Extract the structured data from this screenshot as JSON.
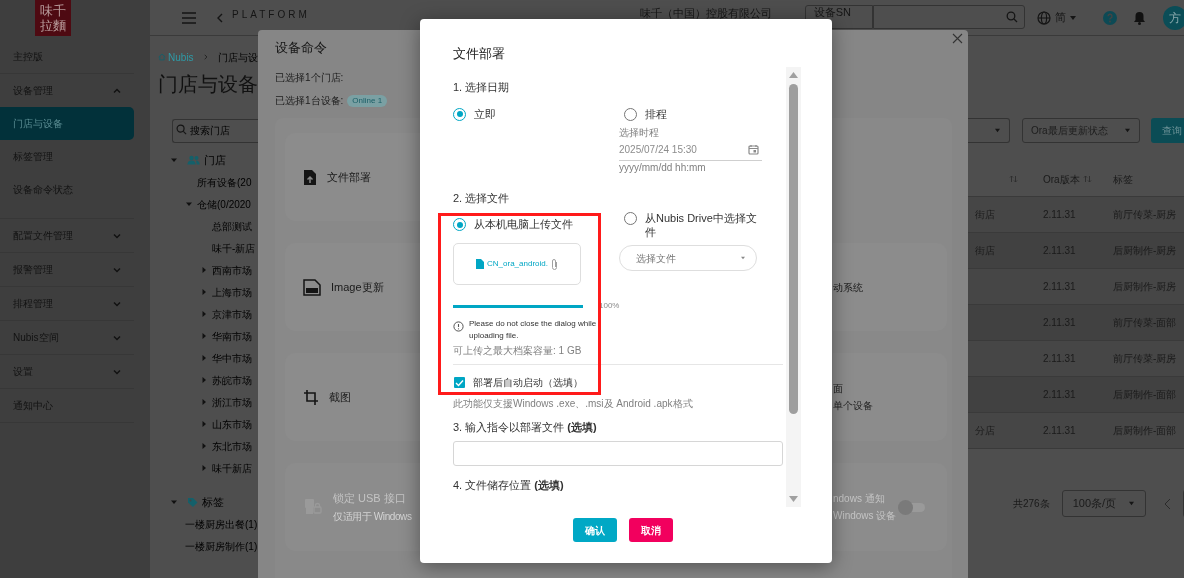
{
  "sidebar": {
    "logo": "味千拉麵",
    "items": [
      {
        "kind": "link",
        "label": "主控版",
        "selected": false
      },
      {
        "kind": "group",
        "label": "设备管理",
        "selected": false,
        "expanded": true,
        "children": [
          {
            "label": "门店与设备",
            "selected": true
          },
          {
            "label": "标签管理",
            "selected": false
          },
          {
            "label": "设备命令状态",
            "selected": false
          }
        ]
      },
      {
        "kind": "group",
        "label": "配置文件管理",
        "selected": false,
        "expanded": false
      },
      {
        "kind": "group",
        "label": "报警管理",
        "selected": false,
        "expanded": false
      },
      {
        "kind": "group",
        "label": "排程管理",
        "selected": false,
        "expanded": false
      },
      {
        "kind": "group",
        "label": "Nubis空间",
        "selected": false,
        "expanded": false
      },
      {
        "kind": "group",
        "label": "设置",
        "selected": false,
        "expanded": false
      },
      {
        "kind": "link",
        "label": "通知中心",
        "selected": false
      }
    ]
  },
  "topbar": {
    "title": "PLATFORM",
    "company": "味千（中国）控股有限公司",
    "search_type": "设备SN",
    "language": "简",
    "avatar": "方"
  },
  "breadcrumb": [
    {
      "label": "Nubis",
      "kind": "home"
    },
    {
      "label": "门店与设"
    }
  ],
  "page_title": "门店与设备",
  "tree": {
    "search_placeholder": "搜索门店",
    "groups": [
      {
        "label": "门店",
        "kind": "store",
        "expanded": true,
        "children": [
          {
            "label": "所有设备(20"
          },
          {
            "label": "仓储(0/2020",
            "expanded": true,
            "children": [
              {
                "label": "总部测试"
              },
              {
                "label": "味千-新店"
              },
              {
                "label": "西南市场",
                "expanded": false
              },
              {
                "label": "上海市场",
                "expanded": false
              },
              {
                "label": "京津市场",
                "expanded": false
              },
              {
                "label": "华南市场",
                "expanded": false
              },
              {
                "label": "华中市场",
                "expanded": false
              },
              {
                "label": "苏皖市场",
                "expanded": false
              },
              {
                "label": "浙江市场",
                "expanded": false
              },
              {
                "label": "山东市场",
                "expanded": false
              },
              {
                "label": "东北市场",
                "expanded": false
              },
              {
                "label": "味千新店",
                "expanded": false
              }
            ]
          }
        ]
      },
      {
        "label": "标签",
        "kind": "tag",
        "expanded": true,
        "children": [
          {
            "label": "一楼厨房出餐(1)"
          },
          {
            "label": "一楼厨房制作(1)"
          }
        ]
      }
    ]
  },
  "filters": {
    "status_select": "Ora最后更新状态",
    "query_button": "查询"
  },
  "table": {
    "columns": [
      {
        "sortable": true
      },
      {
        "label": "Ora版本",
        "sortable": true
      },
      {
        "label": "标签",
        "sortable": false
      }
    ],
    "rows": [
      {
        "column_1": "街店",
        "version": "2.11.31",
        "tag": "前厅传菜-厨房"
      },
      {
        "column_1": "街店",
        "version": "2.11.31",
        "tag": "后厨制作-厨房"
      },
      {
        "version": "2.11.31",
        "tag": "后厨制作-厨房"
      },
      {
        "version": "2.11.31",
        "tag": "前厅传菜-面部"
      },
      {
        "version": "2.11.31",
        "tag": "前厅传菜-厨房"
      },
      {
        "version": "2.11.31",
        "tag": "后厨制作-面部"
      },
      {
        "column_1": "分店",
        "version": "2.11.31",
        "tag": "后厨制作-面部"
      }
    ]
  },
  "pagination": {
    "total": "共276条",
    "page_size": "100条/页"
  },
  "command_panel": {
    "title": "设备命令",
    "stores_selected": "已选择1个门店:",
    "devices_selected": "已选择1台设备:",
    "status_badge": "Online 1",
    "commands": [
      {
        "kind": "file",
        "label": "文件部署",
        "disabled": false
      },
      {
        "kind": "iso",
        "label": "Image更新",
        "disabled": false
      },
      {
        "kind": "crop",
        "label": "截图",
        "disabled": false
      },
      {
        "kind": "usb",
        "label": "锁定 USB 接口",
        "subtitle": "仅适用于 Windows",
        "disabled": true
      }
    ],
    "right_column": [
      {
        "label": "动系统"
      },
      {
        "label": "面",
        "subtitle": "单个设备"
      },
      {
        "label": "ndows 通知",
        "subtitle": "Windows 设备",
        "toggle_on": false
      }
    ]
  },
  "dialog": {
    "title": "文件部署",
    "step1": {
      "heading": "1. 选择日期",
      "options": [
        {
          "label": "立即",
          "selected": true
        },
        {
          "label": "排程",
          "selected": false
        }
      ],
      "schedule_field": {
        "label": "选择时程",
        "value": "2025/07/24 15:30",
        "hint": "yyyy/mm/dd hh:mm",
        "disabled": true
      }
    },
    "step2": {
      "heading": "2. 选择文件",
      "options": [
        {
          "label": "从本机电脑上传文件",
          "selected": true
        },
        {
          "label": "从Nubis Drive中选择文件",
          "selected": false
        }
      ],
      "upload": {
        "file_name": "CN_ora_android.",
        "level": 1,
        "percent": "100%",
        "warning": "Please do not close the dialog while uploading file.",
        "max_size": "可上传之最大档案容量: 1 GB"
      },
      "drive_select": {
        "placeholder": "选择文件"
      },
      "auto_start": {
        "label": "部署后自动启动（选填）",
        "checked": true
      },
      "note": "此功能仅支援Windows .exe、.msi及 Android .apk格式"
    },
    "step3": {
      "heading": "3. 输入指令以部署文件 **(选填)**"
    },
    "step4": {
      "heading": "4. 文件储存位置 **(选填)**"
    },
    "buttons": [
      {
        "label": "确认",
        "kind": "primary"
      },
      {
        "label": "取消",
        "kind": "danger"
      }
    ]
  }
}
